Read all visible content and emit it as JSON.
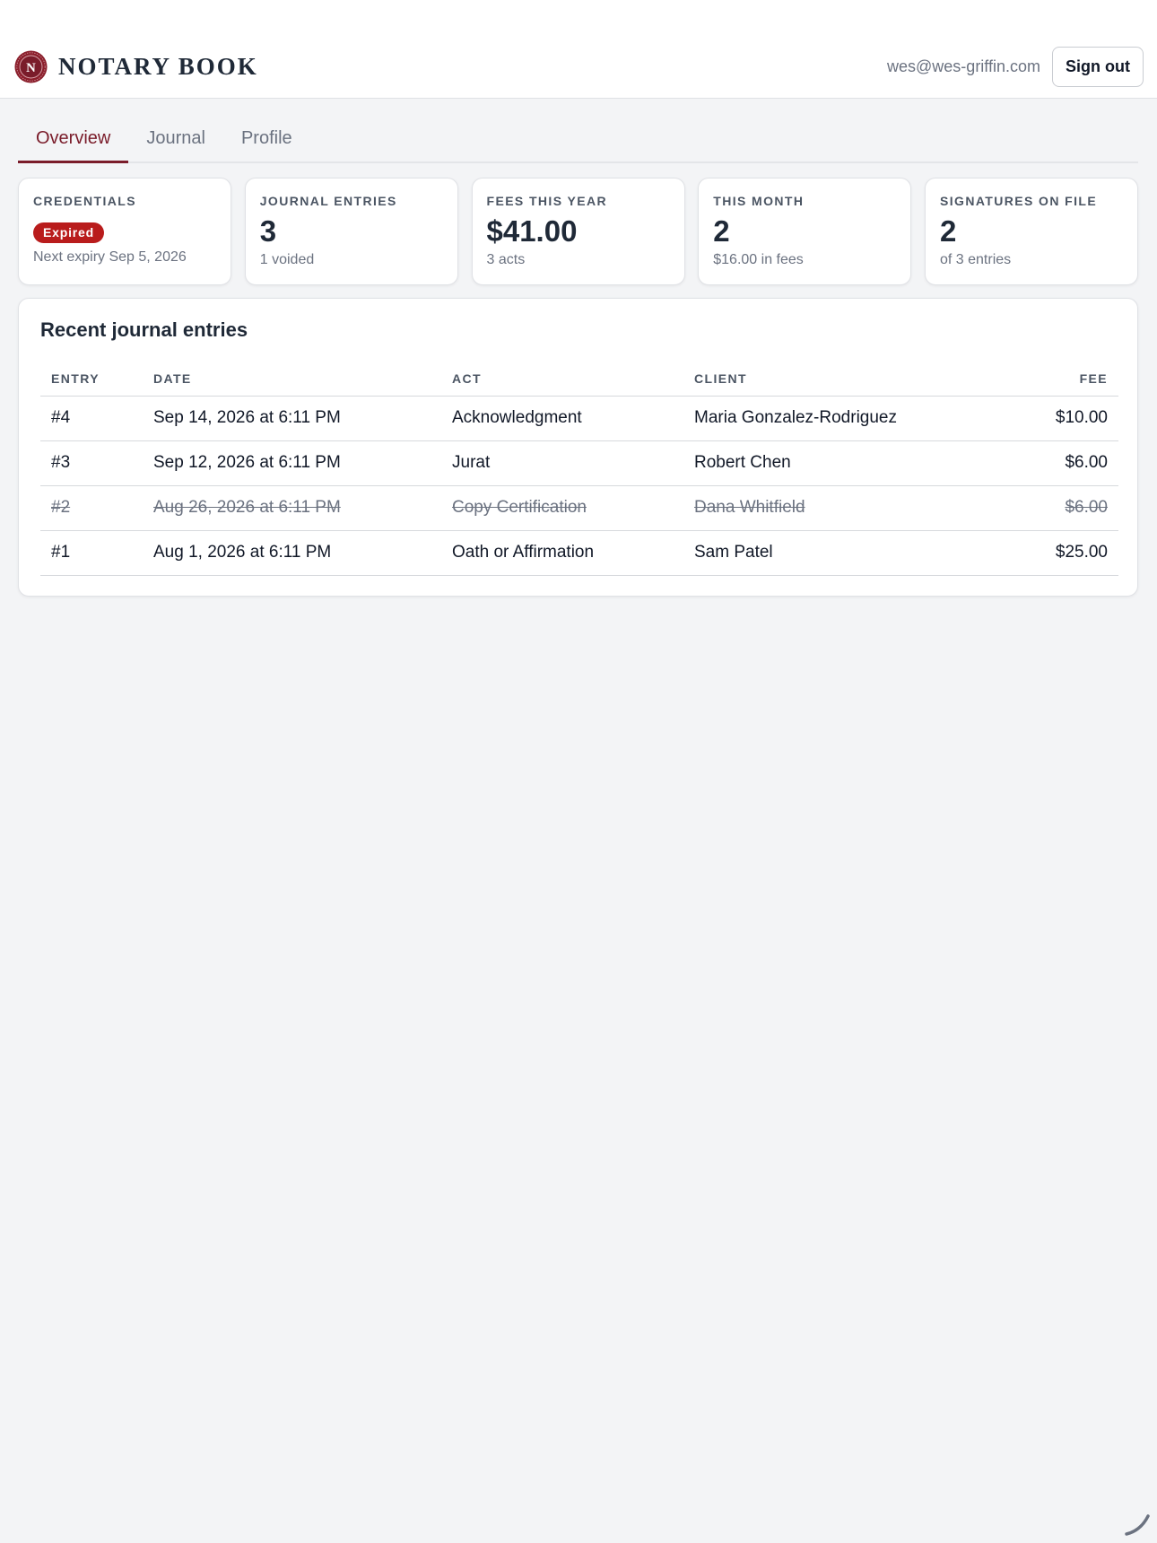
{
  "header": {
    "brand_initial": "N",
    "brand_name": "NOTARY BOOK",
    "user_email": "wes@wes-griffin.com",
    "signout_label": "Sign out"
  },
  "tabs": [
    {
      "label": "Overview",
      "active": true
    },
    {
      "label": "Journal",
      "active": false
    },
    {
      "label": "Profile",
      "active": false
    }
  ],
  "cards": {
    "credentials": {
      "label": "CREDENTIALS",
      "badge": "Expired",
      "sub": "Next expiry Sep 5, 2026"
    },
    "journal_entries": {
      "label": "JOURNAL ENTRIES",
      "value": "3",
      "sub": "1 voided"
    },
    "fees_year": {
      "label": "FEES THIS YEAR",
      "value": "$41.00",
      "sub": "3 acts"
    },
    "this_month": {
      "label": "THIS MONTH",
      "value": "2",
      "sub": "$16.00 in fees"
    },
    "signatures": {
      "label": "SIGNATURES ON FILE",
      "value": "2",
      "sub": "of 3 entries"
    }
  },
  "recent": {
    "title": "Recent journal entries",
    "columns": {
      "entry": "ENTRY",
      "date": "DATE",
      "act": "ACT",
      "client": "CLIENT",
      "fee": "FEE"
    },
    "rows": [
      {
        "entry": "#4",
        "date": "Sep 14, 2026 at 6:11 PM",
        "act": "Acknowledgment",
        "client": "Maria Gonzalez-Rodriguez",
        "fee": "$10.00",
        "voided": false
      },
      {
        "entry": "#3",
        "date": "Sep 12, 2026 at 6:11 PM",
        "act": "Jurat",
        "client": "Robert Chen",
        "fee": "$6.00",
        "voided": false
      },
      {
        "entry": "#2",
        "date": "Aug 26, 2026 at 6:11 PM",
        "act": "Copy Certification",
        "client": "Dana Whitfield",
        "fee": "$6.00",
        "voided": true
      },
      {
        "entry": "#1",
        "date": "Aug 1, 2026 at 6:11 PM",
        "act": "Oath or Affirmation",
        "client": "Sam Patel",
        "fee": "$25.00",
        "voided": false
      }
    ]
  },
  "colors": {
    "accent": "#7a1c2a",
    "badge_expired": "#b91c1c",
    "background": "#f3f4f6"
  }
}
